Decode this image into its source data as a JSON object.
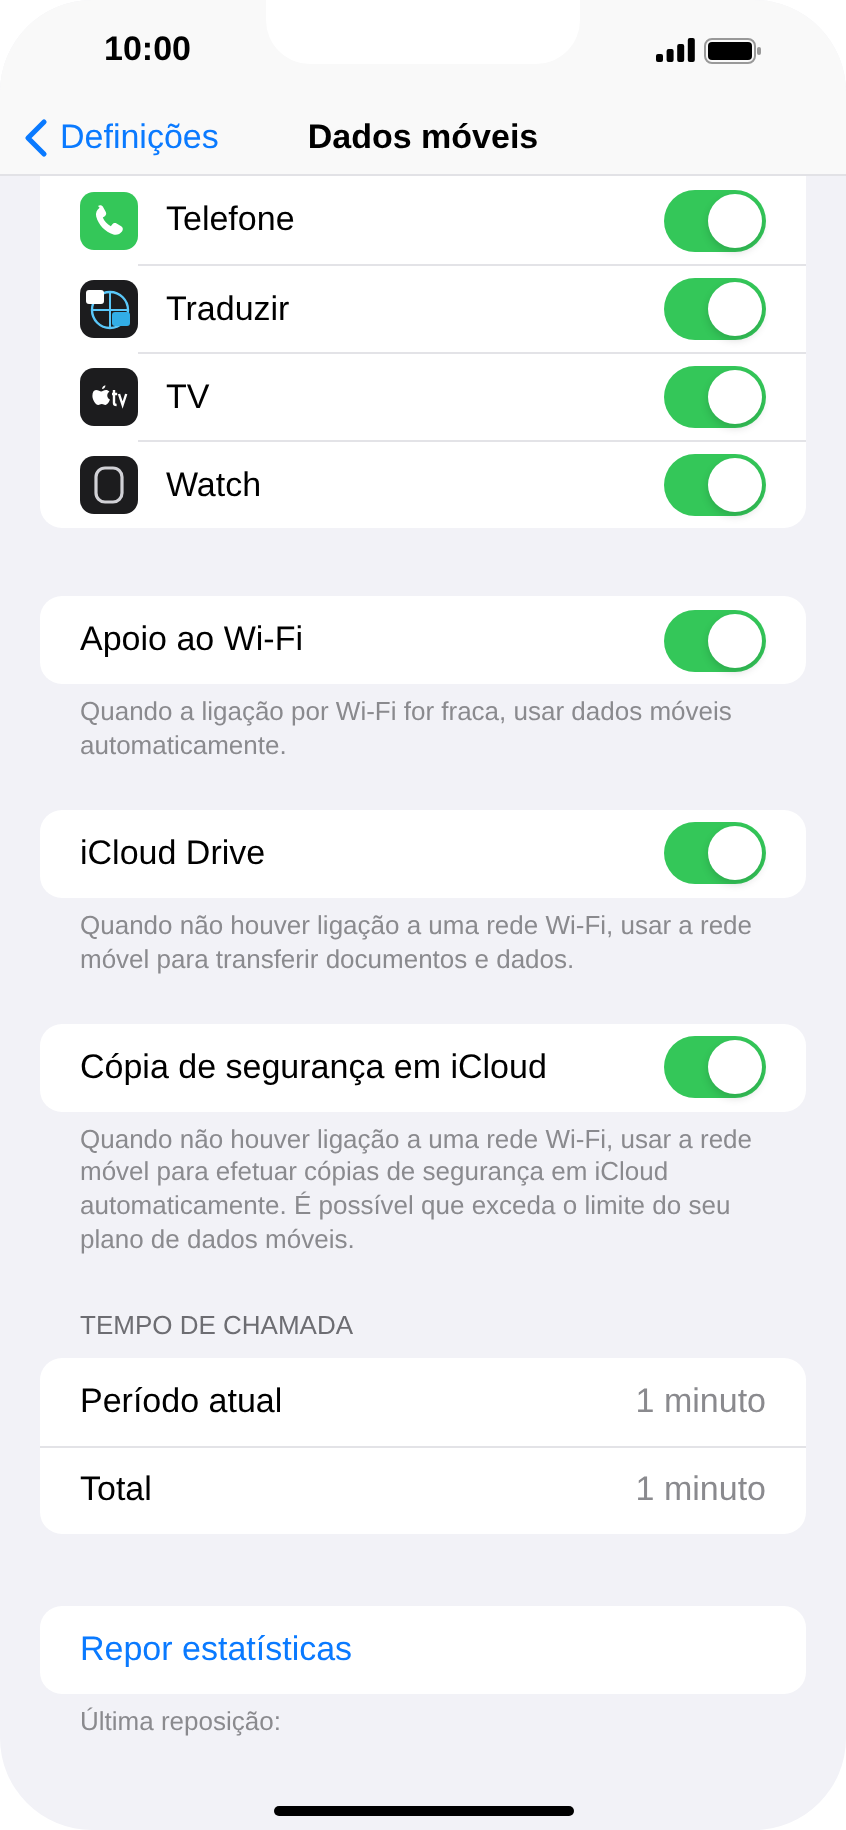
{
  "status_bar": {
    "time": "10:00"
  },
  "nav": {
    "back": "Definições",
    "title": "Dados móveis"
  },
  "apps": [
    {
      "label": "Telefone",
      "on": true
    },
    {
      "label": "Traduzir",
      "on": true
    },
    {
      "label": "TV",
      "on": true
    },
    {
      "label": "Watch",
      "on": true
    }
  ],
  "sections": [
    {
      "label": "Apoio ao Wi-Fi",
      "on": true,
      "footer": "Quando a ligação por Wi-Fi for fraca, usar dados móveis automaticamente."
    },
    {
      "label": "iCloud Drive",
      "on": true,
      "footer": "Quando não houver ligação a uma rede Wi-Fi, usar a rede móvel para transferir documentos e dados."
    },
    {
      "label": "Cópia de segurança em iCloud",
      "on": true,
      "footer": "Quando não houver ligação a uma rede Wi-Fi, usar a rede móvel para efetuar cópias de segurança em iCloud automaticamente. É possível que exceda o limite do seu plano de dados móveis."
    }
  ],
  "call_time": {
    "header": "TEMPO DE CHAMADA",
    "rows": [
      {
        "label": "Período atual",
        "value": "1 minuto"
      },
      {
        "label": "Total",
        "value": "1 minuto"
      }
    ]
  },
  "reset": {
    "action": "Repor estatísticas",
    "footer": "Última reposição:"
  }
}
